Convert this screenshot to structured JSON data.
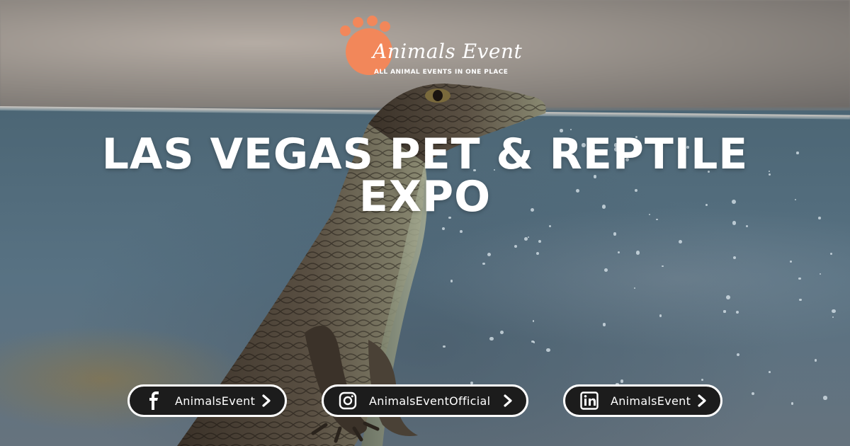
{
  "logo": {
    "brand": "Animals Event",
    "tagline": "ALL ANIMAL EVENTS IN ONE PLACE",
    "accent_color": "#f2875a"
  },
  "headline": {
    "line1": "LAS VEGAS PET & REPTILE",
    "line2": "EXPO"
  },
  "social": [
    {
      "platform": "facebook",
      "icon": "facebook-icon",
      "handle": "AnimalsEvent"
    },
    {
      "platform": "instagram",
      "icon": "instagram-icon",
      "handle": "AnimalsEventOfficial"
    },
    {
      "platform": "linkedin",
      "icon": "linkedin-icon",
      "handle": "AnimalsEvent"
    }
  ],
  "colors": {
    "pill_background": "#1c1c1c",
    "pill_border": "#ffffff",
    "text": "#ffffff"
  }
}
